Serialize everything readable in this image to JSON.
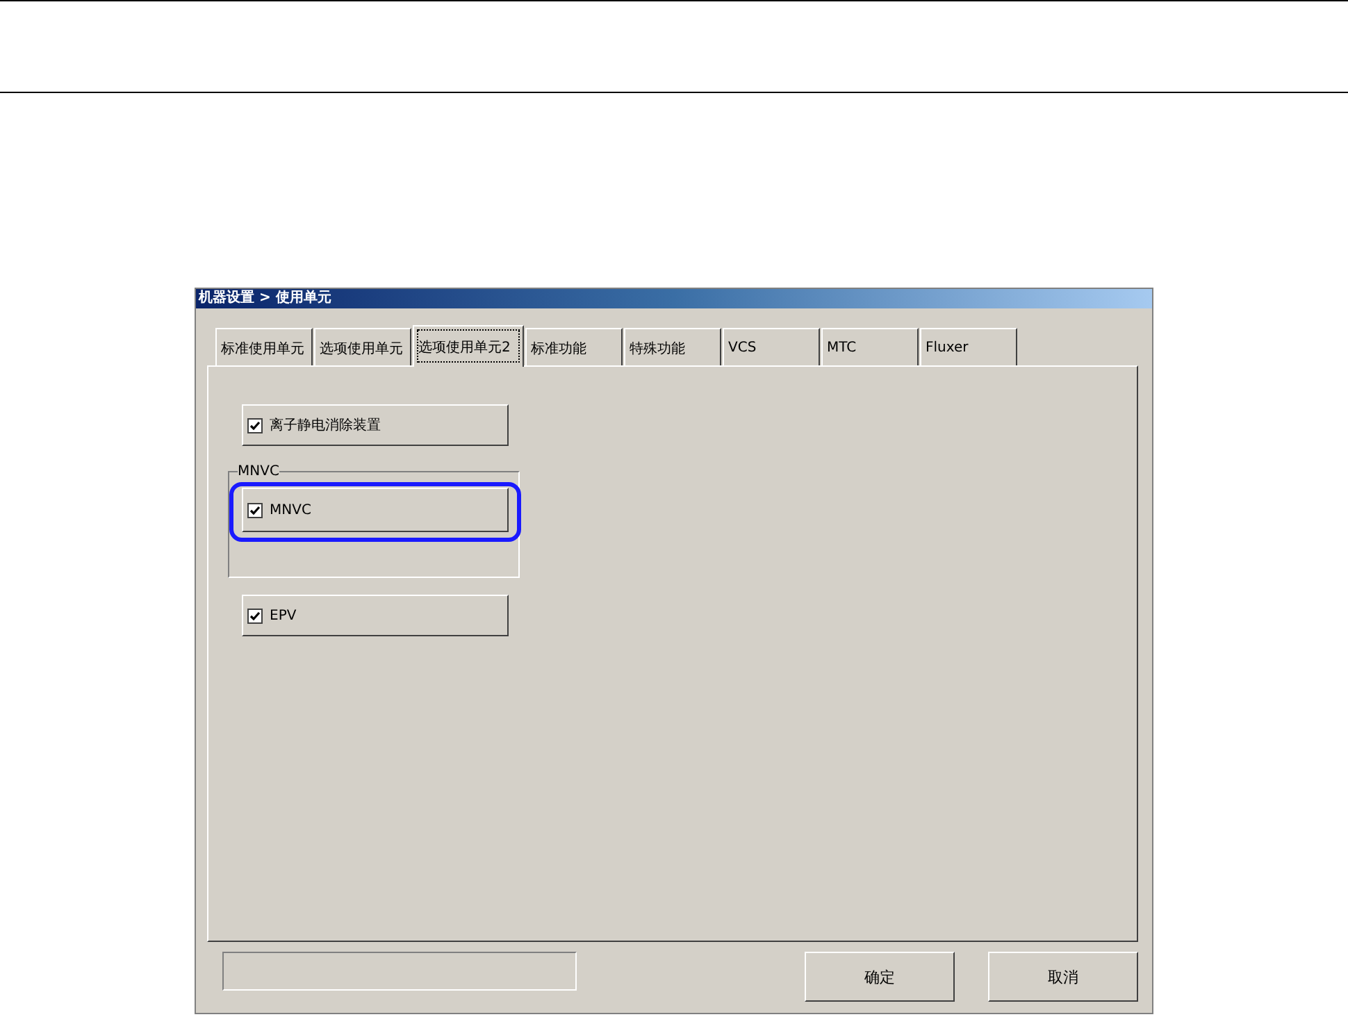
{
  "window": {
    "title": "机器设置 > 使用单元"
  },
  "tabs": [
    {
      "label": "标准使用单元",
      "selected": false
    },
    {
      "label": "选项使用单元",
      "selected": false
    },
    {
      "label": "选项使用单元2",
      "selected": true
    },
    {
      "label": "标准功能",
      "selected": false
    },
    {
      "label": "特殊功能",
      "selected": false
    },
    {
      "label": "VCS",
      "selected": false
    },
    {
      "label": "MTC",
      "selected": false
    },
    {
      "label": "Fluxer",
      "selected": false
    }
  ],
  "options": [
    {
      "kind": "checkbox",
      "label": "离子静电消除装置",
      "checked": true
    },
    {
      "kind": "group",
      "title": "MNVC",
      "items": [
        {
          "label": "MNVC",
          "checked": true,
          "highlighted": true
        }
      ]
    },
    {
      "kind": "checkbox",
      "label": "EPV",
      "checked": true
    }
  ],
  "buttons": [
    "确定",
    "取消"
  ]
}
